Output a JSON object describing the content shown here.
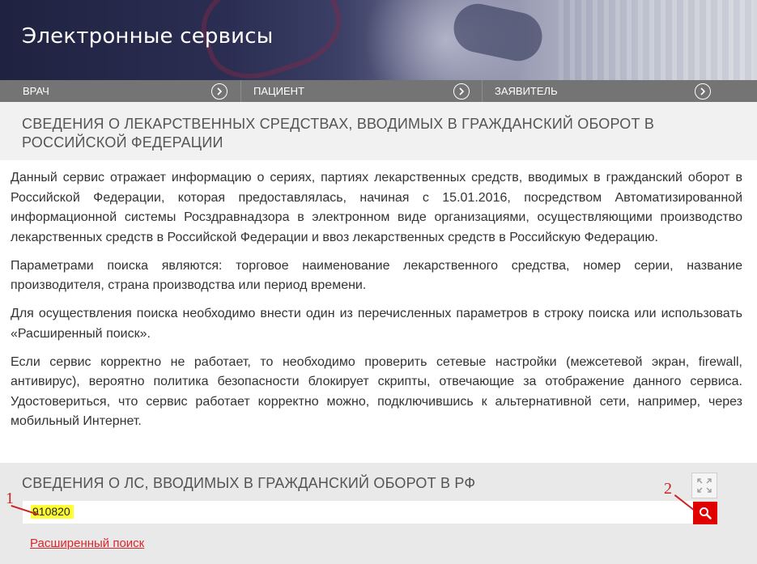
{
  "header": {
    "title": "Электронные сервисы"
  },
  "nav": {
    "items": [
      {
        "label": "ВРАЧ"
      },
      {
        "label": "ПАЦИЕНТ"
      },
      {
        "label": "ЗАЯВИТЕЛЬ"
      }
    ]
  },
  "section": {
    "title": "СВЕДЕНИЯ О ЛЕКАРСТВЕННЫХ СРЕДСТВАХ, ВВОДИМЫХ В ГРАЖДАНСКИЙ ОБОРОТ В РОССИЙСКОЙ ФЕДЕРАЦИИ"
  },
  "content": {
    "paragraphs": [
      "Данный сервис отражает информацию о сериях, партиях лекарственных средств, вводимых в гражданский оборот в Российской Федерации, которая предоставлялась, начиная с 15.01.2016, посредством Автоматизированной информационной системы Росздравнадзора в электронном виде организациями, осуществляющими производство лекарственных средств в Российской Федерации и ввоз лекарственных средств в Российскую Федерацию.",
      "Параметрами поиска являются: торговое наименование лекарственного средства, номер серии, название производителя, страна производства или период времени.",
      "Для осуществления поиска необходимо внести один из  перечисленных параметров в строку поиска или  использовать «Расширенный поиск».",
      "Если сервис корректно не работает, то необходимо проверить сетевые настройки (межсетевой экран, firewall, антивирус), вероятно политика безопасности блокирует скрипты, отвечающие за отображение данного сервиса. Удостовериться, что сервис работает корректно можно, подключившись к альтернативной сети, например, через мобильный Интернет."
    ]
  },
  "search": {
    "title": "СВЕДЕНИЯ О ЛС, ВВОДИМЫХ В ГРАЖДАНСКИЙ ОБОРОТ В РФ",
    "value": "910820",
    "advanced_link": "Расширенный поиск"
  },
  "annotations": {
    "one": "1",
    "two": "2"
  },
  "colors": {
    "nav_bg": "#747474",
    "search_button": "#e00000",
    "link": "#d9262a",
    "highlight": "#ffff33",
    "annotation": "#cc2222"
  },
  "icons": {
    "nav_arrow": "chevron-right-circle-icon",
    "expand": "expand-icon",
    "search": "search-icon"
  }
}
